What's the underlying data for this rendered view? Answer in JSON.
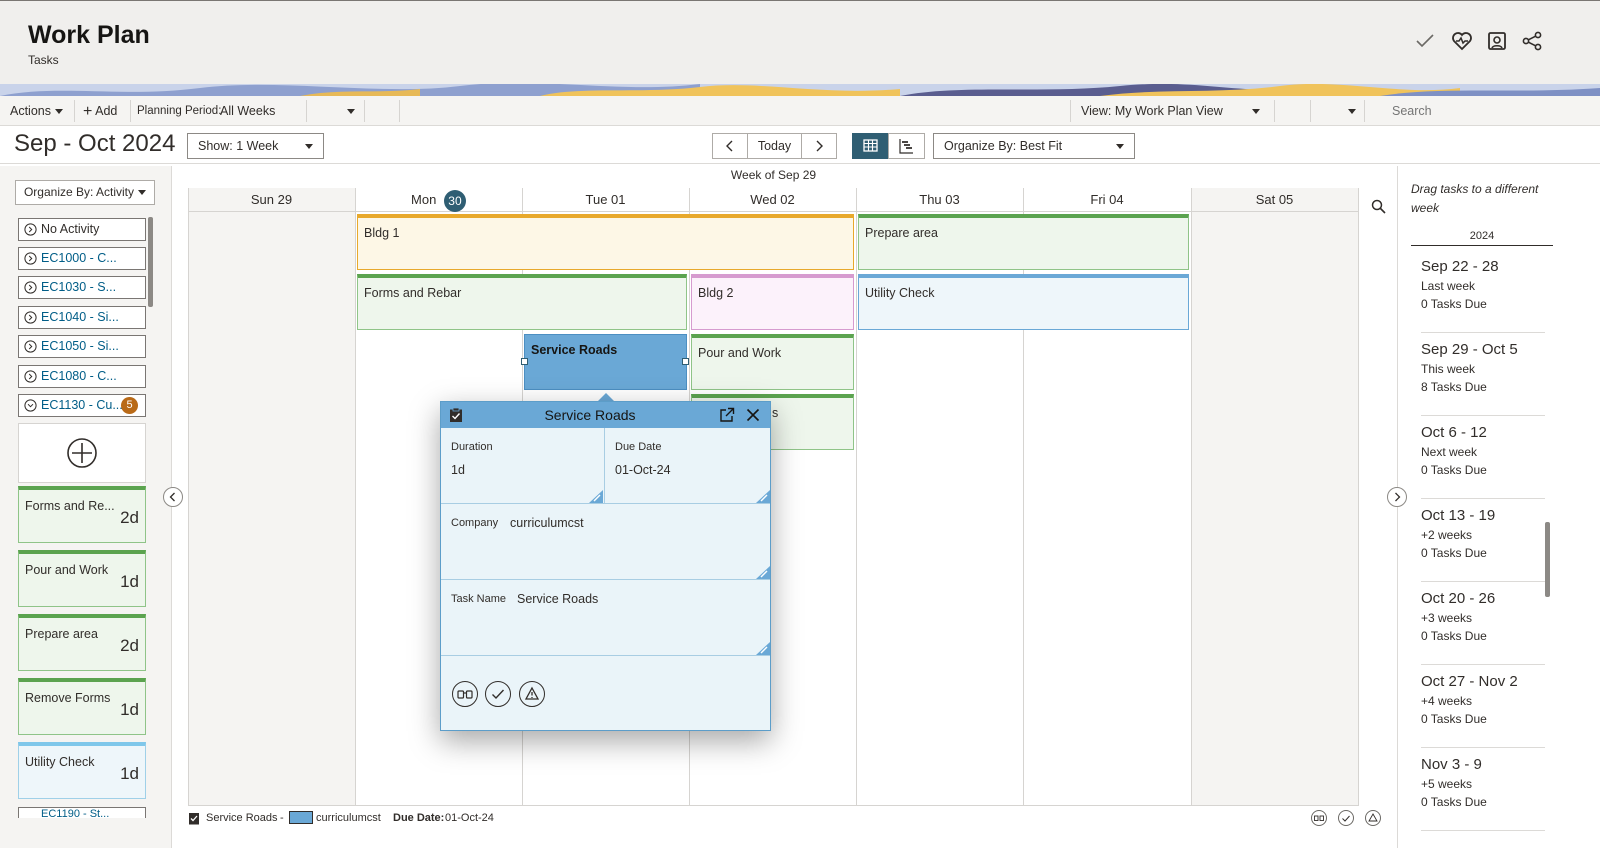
{
  "header": {
    "title": "Work Plan",
    "subtitle": "Tasks"
  },
  "toolbar": {
    "actions_label": "Actions",
    "add_label": "Add",
    "planning_period_label": "Planning Period:",
    "planning_period_value": "All Weeks",
    "view_label": "View: My Work Plan View",
    "search_placeholder": "Search"
  },
  "period": {
    "title": "Sep - Oct 2024",
    "show_select": "Show: 1 Week",
    "today_label": "Today",
    "organize_select": "Organize By: Best Fit"
  },
  "left": {
    "organize_label": "Organize By: Activity",
    "activities": [
      {
        "label": "No Activity"
      },
      {
        "label": "EC1000 - C..."
      },
      {
        "label": "EC1030 - S..."
      },
      {
        "label": "EC1040 - Si..."
      },
      {
        "label": "EC1050 - Si..."
      },
      {
        "label": "EC1080 - C..."
      },
      {
        "label": "EC1130 - Cu...",
        "badge": "5"
      }
    ],
    "cards": [
      {
        "name": "Forms and Re...",
        "duration": "2d"
      },
      {
        "name": "Pour and Work",
        "duration": "1d"
      },
      {
        "name": "Prepare area",
        "duration": "2d"
      },
      {
        "name": "Remove Forms",
        "duration": "1d"
      },
      {
        "name": "Utility Check",
        "duration": "1d"
      }
    ],
    "cut_item": "EC1190 - St..."
  },
  "calendar": {
    "week_title": "Week of Sep 29",
    "days": [
      {
        "label": "Sun 29"
      },
      {
        "label": "Mon",
        "badge": "30"
      },
      {
        "label": "Tue 01"
      },
      {
        "label": "Wed 02"
      },
      {
        "label": "Thu 03"
      },
      {
        "label": "Fri 04"
      },
      {
        "label": "Sat 05"
      }
    ],
    "tasks": {
      "bldg1": "Bldg 1",
      "prepare_area": "Prepare area",
      "forms_rebar": "Forms and Rebar",
      "bldg2": "Bldg 2",
      "utility_check": "Utility Check",
      "service_roads": "Service Roads",
      "pour_work": "Pour and Work",
      "remove_forms_partial": "s"
    }
  },
  "popup": {
    "title": "Service Roads",
    "duration_label": "Duration",
    "duration_value": "1d",
    "due_label": "Due Date",
    "due_value": "01-Oct-24",
    "company_label": "Company",
    "company_value": "curriculumcst",
    "taskname_label": "Task Name",
    "taskname_value": "Service Roads"
  },
  "right": {
    "hint": "Drag tasks to a different week",
    "year": "2024",
    "weeks": [
      {
        "range": "Sep 22 - 28",
        "label": "Last week",
        "count": "0 Tasks Due"
      },
      {
        "range": "Sep 29 - Oct 5",
        "label": "This week",
        "count": "8 Tasks Due"
      },
      {
        "range": "Oct 6 - 12",
        "label": "Next week",
        "count": "0 Tasks Due"
      },
      {
        "range": "Oct 13 - 19",
        "label": "+2 weeks",
        "count": "0 Tasks Due"
      },
      {
        "range": "Oct 20 - 26",
        "label": "+3 weeks",
        "count": "0 Tasks Due"
      },
      {
        "range": "Oct 27 - Nov 2",
        "label": "+4 weeks",
        "count": "0 Tasks Due"
      },
      {
        "range": "Nov 3 - 9",
        "label": "+5 weeks",
        "count": "0 Tasks Due"
      }
    ]
  },
  "footer": {
    "task": "Service Roads",
    "dash": "-",
    "company": "curriculumcst",
    "due_label": "Due Date:",
    "due_value": "01-Oct-24"
  },
  "colors": {
    "selected_task": "#6aa8d6",
    "green_task": "#5ba34f",
    "yellow_task": "#e8a92c",
    "pink_task": "#d69bcf",
    "blue_task": "#6aa8d6",
    "badge_orange": "#b96a17",
    "today_badge": "#2f5e73"
  },
  "icons": [
    "check-icon",
    "health-icon",
    "profile-icon",
    "share-icon",
    "calendar-icon",
    "link-icon",
    "print-icon",
    "wrench-icon",
    "filter-icon",
    "search-icon",
    "grid-view-icon",
    "gantt-view-icon",
    "chevron-left-icon",
    "chevron-right-icon",
    "add-circle-icon",
    "binoculars-icon",
    "warning-icon",
    "close-icon",
    "open-external-icon",
    "task-icon"
  ]
}
